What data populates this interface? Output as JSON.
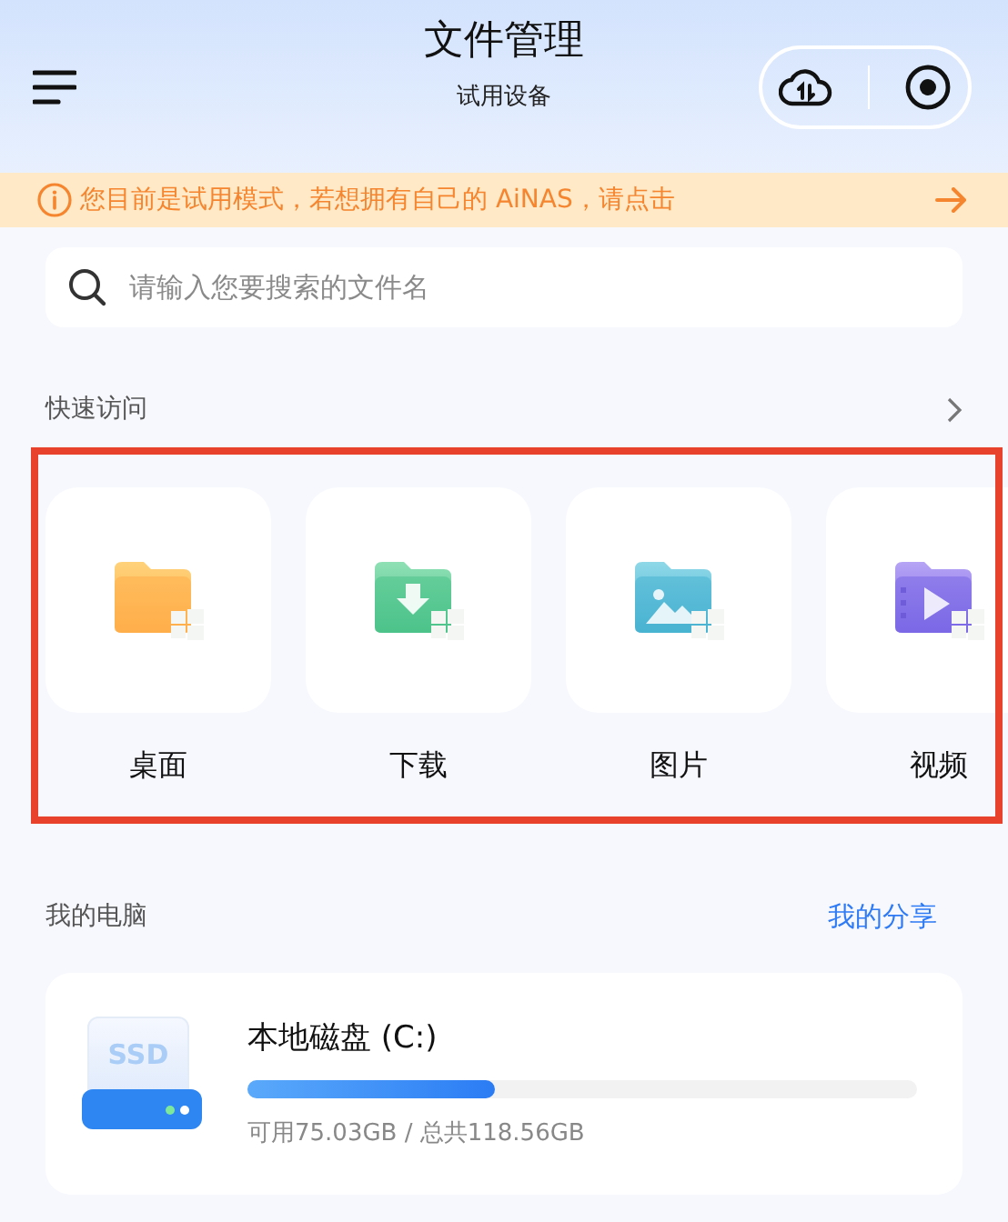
{
  "header": {
    "title": "文件管理",
    "subtitle": "试用设备"
  },
  "banner": {
    "text": "您目前是试用模式，若想拥有自己的 AiNAS，请点击"
  },
  "search": {
    "placeholder": "请输入您要搜索的文件名"
  },
  "quick_access": {
    "title": "快速访问",
    "items": [
      {
        "label": "桌面",
        "kind": "desktop"
      },
      {
        "label": "下载",
        "kind": "download"
      },
      {
        "label": "图片",
        "kind": "image"
      },
      {
        "label": "视频",
        "kind": "video"
      }
    ]
  },
  "my_computer": {
    "title": "我的电脑",
    "link": "我的分享",
    "drives": [
      {
        "icon_label": "SSD",
        "name": "本地磁盘 (C:)",
        "level": 0.37,
        "usage": "可用75.03GB / 总共118.56GB"
      }
    ]
  }
}
